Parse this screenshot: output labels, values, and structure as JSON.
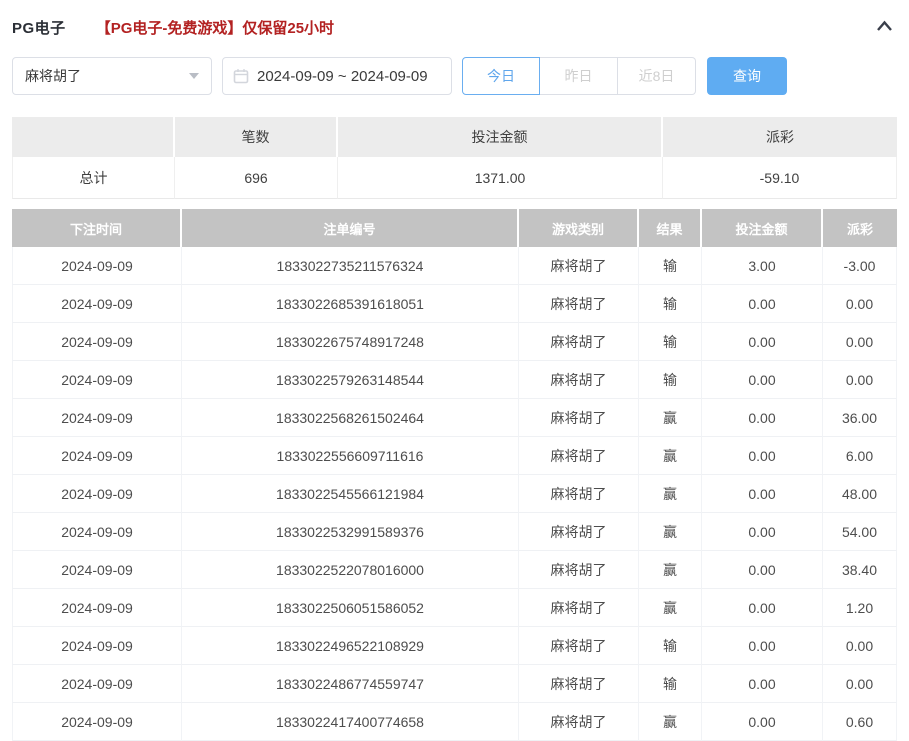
{
  "header": {
    "title": "PG电子",
    "subtitle": "【PG电子-免费游戏】仅保留25小时"
  },
  "filters": {
    "game_select": {
      "value": "麻将胡了",
      "caret_icon": "chevron-down"
    },
    "date_range": {
      "value": "2024-09-09 ~ 2024-09-09",
      "icon": "calendar"
    },
    "quick_buttons": [
      {
        "label": "今日",
        "active": true
      },
      {
        "label": "昨日",
        "active": false
      },
      {
        "label": "近8日",
        "active": false
      }
    ],
    "search_label": "查询"
  },
  "summary": {
    "headers": {
      "label": "",
      "count": "笔数",
      "bet_amount": "投注金额",
      "payout": "派彩"
    },
    "row": {
      "label": "总计",
      "count": "696",
      "bet_amount": "1371.00",
      "payout": "-59.10"
    }
  },
  "table": {
    "headers": [
      "下注时间",
      "注单编号",
      "游戏类别",
      "结果",
      "投注金额",
      "派彩"
    ],
    "rows": [
      [
        "2024-09-09",
        "1833022735211576324",
        "麻将胡了",
        "输",
        "3.00",
        "-3.00"
      ],
      [
        "2024-09-09",
        "1833022685391618051",
        "麻将胡了",
        "输",
        "0.00",
        "0.00"
      ],
      [
        "2024-09-09",
        "1833022675748917248",
        "麻将胡了",
        "输",
        "0.00",
        "0.00"
      ],
      [
        "2024-09-09",
        "1833022579263148544",
        "麻将胡了",
        "输",
        "0.00",
        "0.00"
      ],
      [
        "2024-09-09",
        "1833022568261502464",
        "麻将胡了",
        "赢",
        "0.00",
        "36.00"
      ],
      [
        "2024-09-09",
        "1833022556609711616",
        "麻将胡了",
        "赢",
        "0.00",
        "6.00"
      ],
      [
        "2024-09-09",
        "1833022545566121984",
        "麻将胡了",
        "赢",
        "0.00",
        "48.00"
      ],
      [
        "2024-09-09",
        "1833022532991589376",
        "麻将胡了",
        "赢",
        "0.00",
        "54.00"
      ],
      [
        "2024-09-09",
        "1833022522078016000",
        "麻将胡了",
        "赢",
        "0.00",
        "38.40"
      ],
      [
        "2024-09-09",
        "1833022506051586052",
        "麻将胡了",
        "赢",
        "0.00",
        "1.20"
      ],
      [
        "2024-09-09",
        "1833022496522108929",
        "麻将胡了",
        "输",
        "0.00",
        "0.00"
      ],
      [
        "2024-09-09",
        "1833022486774559747",
        "麻将胡了",
        "输",
        "0.00",
        "0.00"
      ],
      [
        "2024-09-09",
        "1833022417400774658",
        "麻将胡了",
        "赢",
        "0.00",
        "0.60"
      ]
    ]
  },
  "colors": {
    "accent_blue": "#5facf2",
    "active_tab_blue": "#6aaef0",
    "negative_red": "#f15b5b",
    "title_red": "#b32222",
    "table_header_gray": "#c3c3c3",
    "summary_header_gray": "#ececec"
  }
}
